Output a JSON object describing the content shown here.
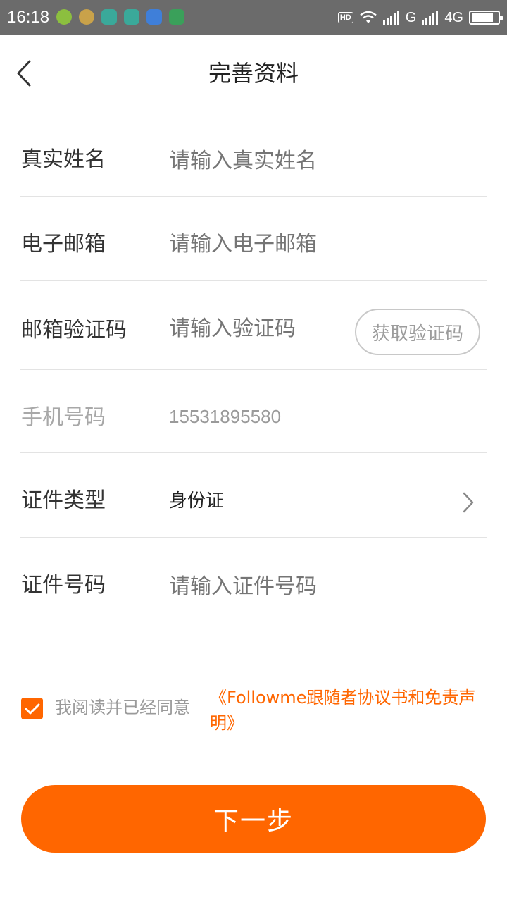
{
  "status_bar": {
    "time": "16:18",
    "hd": "HD",
    "network_1": "G",
    "network_2": "4G",
    "battery_level": 0.85,
    "app_icons": [
      "plus-app-icon",
      "gold-app-icon",
      "teal-app-icon",
      "teal-app-icon",
      "weather-app-icon",
      "vpn-app-icon"
    ]
  },
  "header": {
    "title": "完善资料",
    "back_icon": "chevron-left-icon"
  },
  "form": {
    "real_name": {
      "label": "真实姓名",
      "placeholder": "请输入真实姓名"
    },
    "email": {
      "label": "电子邮箱",
      "placeholder": "请输入电子邮箱"
    },
    "email_code": {
      "label": "邮箱验证码",
      "placeholder": "请输入验证码",
      "button": "获取验证码"
    },
    "phone": {
      "label": "手机号码",
      "value": "15531895580"
    },
    "id_type": {
      "label": "证件类型",
      "value": "身份证",
      "chevron_icon": "chevron-right-icon"
    },
    "id_number": {
      "label": "证件号码",
      "placeholder": "请输入证件号码"
    }
  },
  "agreement": {
    "checked": true,
    "text": "我阅读并已经同意",
    "link": "《Followme跟随者协议书和免责声明》"
  },
  "next_button": "下一步",
  "colors": {
    "accent": "#ff6600",
    "status_bar": "#6b6b6b",
    "divider": "#e3e3e3"
  }
}
